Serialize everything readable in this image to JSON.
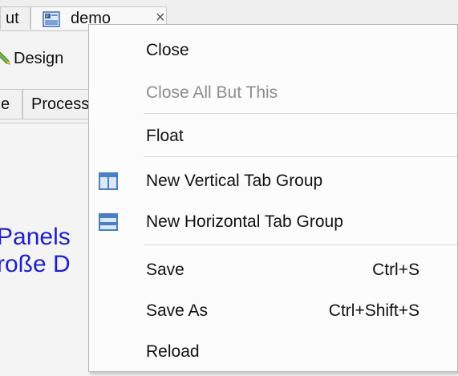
{
  "background": {
    "left_tab_label": "ut",
    "active_tab_label": "demo",
    "active_tab_close": "×",
    "design_label": "Design",
    "subtabs": [
      "e",
      "Process"
    ],
    "panel_lines": [
      "Panels",
      "roße D"
    ],
    "panel_text_color": "#1f1fcc"
  },
  "context_menu": {
    "items": [
      {
        "label": "Close",
        "enabled": true
      },
      {
        "label": "Close All But This",
        "enabled": false
      },
      {
        "label": "Float",
        "enabled": true
      },
      {
        "label": "New Vertical Tab Group",
        "enabled": true,
        "icon": "vertical-tab-group-icon"
      },
      {
        "label": "New Horizontal Tab Group",
        "enabled": true,
        "icon": "horizontal-tab-group-icon"
      },
      {
        "label": "Save",
        "shortcut": "Ctrl+S",
        "enabled": true
      },
      {
        "label": "Save As",
        "shortcut": "Ctrl+Shift+S",
        "enabled": true
      },
      {
        "label": "Reload",
        "enabled": true
      }
    ]
  },
  "colors": {
    "menu_background": "#fcfcfc",
    "disabled_text": "#8d8d8d",
    "icon_blue": "#4a7fc1"
  }
}
